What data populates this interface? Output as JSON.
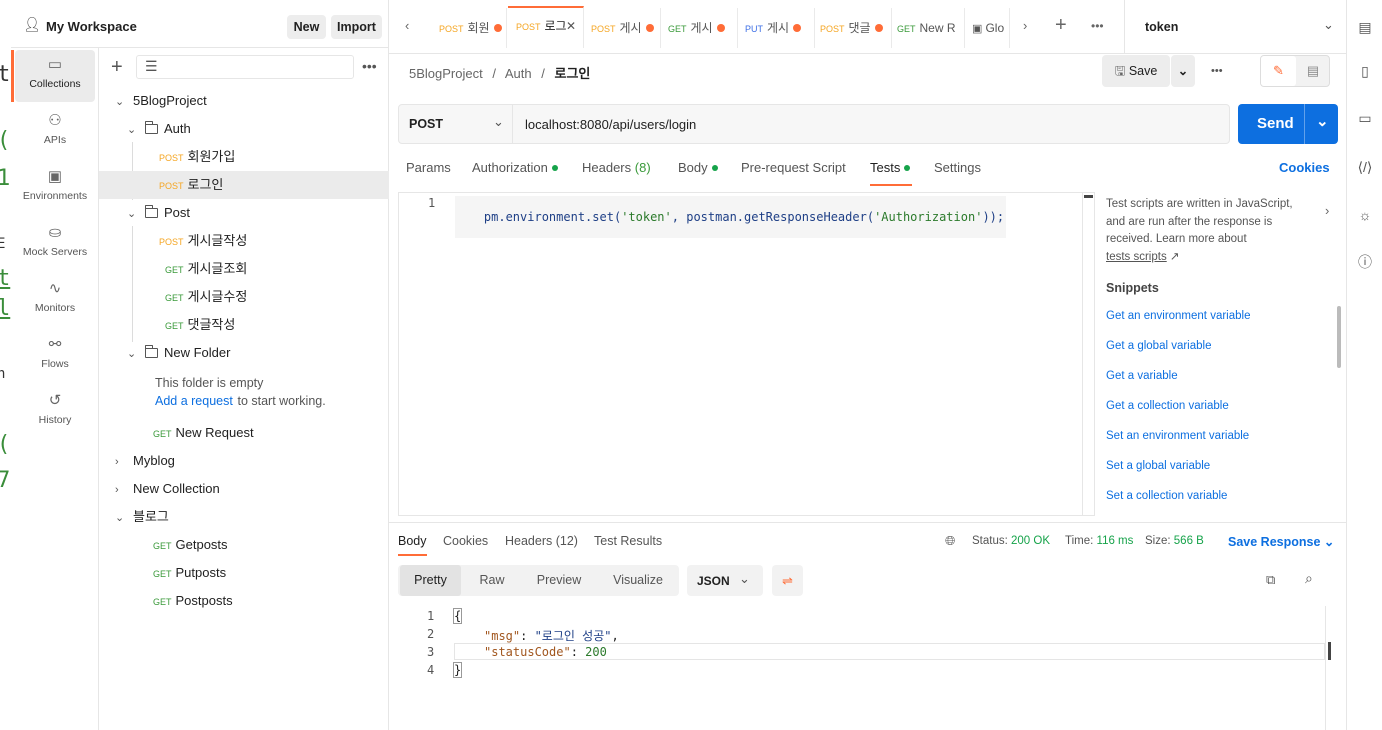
{
  "workspace": {
    "name": "My Workspace",
    "new_label": "New",
    "import_label": "Import"
  },
  "iconbar": [
    {
      "label": "Collections",
      "icon": "collections-icon",
      "glyph": "▭"
    },
    {
      "label": "APIs",
      "icon": "apis-icon",
      "glyph": "⚇"
    },
    {
      "label": "Environments",
      "icon": "environments-icon",
      "glyph": "▣"
    },
    {
      "label": "Mock Servers",
      "icon": "mock-servers-icon",
      "glyph": "⛀"
    },
    {
      "label": "Monitors",
      "icon": "monitors-icon",
      "glyph": "∿"
    },
    {
      "label": "Flows",
      "icon": "flows-icon",
      "glyph": "⚯"
    },
    {
      "label": "History",
      "icon": "history-icon",
      "glyph": "↺"
    }
  ],
  "tree": {
    "collection1": "5BlogProject",
    "auth_folder": "Auth",
    "auth_items": [
      {
        "method": "POST",
        "name": "회원가입"
      },
      {
        "method": "POST",
        "name": "로그인"
      }
    ],
    "post_folder": "Post",
    "post_items": [
      {
        "method": "POST",
        "name": "게시글작성"
      },
      {
        "method": "GET",
        "name": "게시글조회"
      },
      {
        "method": "GET",
        "name": "게시글수정"
      },
      {
        "method": "GET",
        "name": "댓글작성"
      }
    ],
    "new_folder": "New Folder",
    "empty_text": "This folder is empty",
    "add_request": "Add a request",
    "start_text": " to start working.",
    "new_request": {
      "method": "GET",
      "name": "New Request"
    },
    "collection2": "Myblog",
    "collection3": "New Collection",
    "collection4": "블로그",
    "blog_items": [
      {
        "method": "GET",
        "name": "Getposts"
      },
      {
        "method": "GET",
        "name": "Putposts"
      },
      {
        "method": "GET",
        "name": "Postposts"
      }
    ]
  },
  "tabs": [
    {
      "method": "POST",
      "name": "회원"
    },
    {
      "method": "POST",
      "name": "로그"
    },
    {
      "method": "POST",
      "name": "게시"
    },
    {
      "method": "GET",
      "name": "게시"
    },
    {
      "method": "PUT",
      "name": "게시"
    },
    {
      "method": "POST",
      "name": "댓글"
    },
    {
      "method": "GET",
      "name": "New R"
    },
    {
      "method": "",
      "name": "Glo"
    }
  ],
  "environment": "token",
  "breadcrumb": {
    "root": "5BlogProject",
    "sep": "/",
    "folder": "Auth",
    "current": "로그인"
  },
  "save_label": "Save",
  "request": {
    "method": "POST",
    "url": "localhost:8080/api/users/login",
    "send_label": "Send"
  },
  "req_tabs": {
    "params": "Params",
    "auth": "Authorization",
    "headers": "Headers",
    "headers_count": "(8)",
    "body": "Body",
    "prereq": "Pre-request Script",
    "tests": "Tests",
    "settings": "Settings",
    "cookies": "Cookies"
  },
  "editor": {
    "line_no": "1",
    "code_parts": [
      "pm.environment.set(",
      "'token'",
      ", postman.getResponseHeader(",
      "'Authorization'",
      "));"
    ]
  },
  "help": {
    "text": "Test scripts are written in JavaScript, and are run after the response is received. Learn more about",
    "link": "tests scripts",
    "snippets_title": "Snippets",
    "snippets": [
      "Get an environment variable",
      "Get a global variable",
      "Get a variable",
      "Get a collection variable",
      "Set an environment variable",
      "Set a global variable",
      "Set a collection variable"
    ]
  },
  "response": {
    "tabs": {
      "body": "Body",
      "cookies": "Cookies",
      "headers": "Headers (12)",
      "results": "Test Results"
    },
    "status_label": "Status:",
    "status": "200 OK",
    "time_label": "Time:",
    "time": "116 ms",
    "size_label": "Size:",
    "size": "566 B",
    "save_response": "Save Response",
    "views": [
      "Pretty",
      "Raw",
      "Preview",
      "Visualize"
    ],
    "format": "JSON",
    "lines": [
      "1",
      "2",
      "3",
      "4"
    ],
    "json": {
      "open": "{",
      "k1": "\"msg\"",
      "v1": "\"로그인 성공\"",
      "k2": "\"statusCode\"",
      "v2": "200",
      "close": "}"
    }
  },
  "colors": {
    "accent": "#ff6c37",
    "send": "#0d6fe0",
    "post": "#f5a623",
    "get": "#3a9a3a",
    "put": "#3d6fe6"
  }
}
